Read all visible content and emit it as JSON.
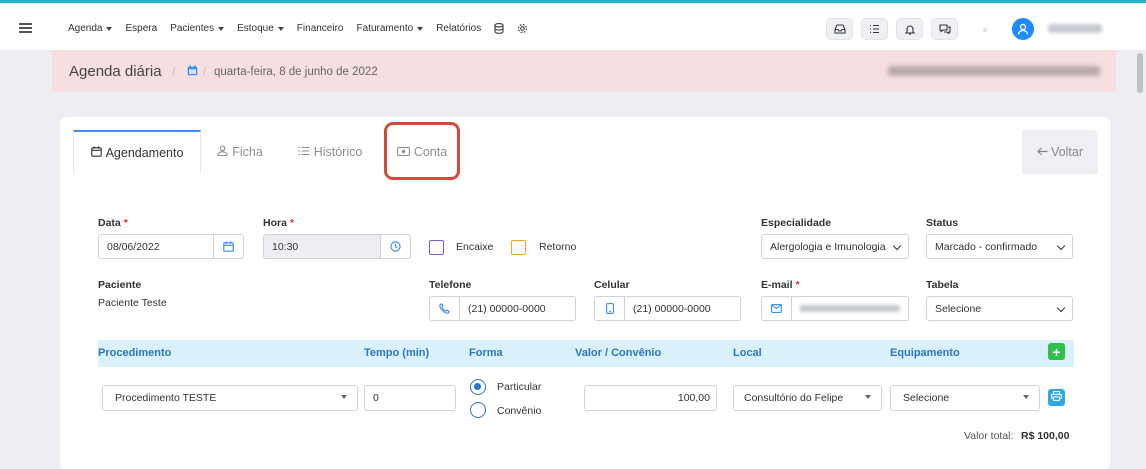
{
  "nav": {
    "items": [
      {
        "label": "Agenda",
        "caret": true
      },
      {
        "label": "Espera",
        "caret": false
      },
      {
        "label": "Pacientes",
        "caret": true
      },
      {
        "label": "Estoque",
        "caret": true
      },
      {
        "label": "Financeiro",
        "caret": false
      },
      {
        "label": "Faturamento",
        "caret": true
      },
      {
        "label": "Relatórios",
        "caret": false
      }
    ],
    "extra_icons": [
      "database-icon",
      "settings-cog-icon"
    ]
  },
  "header_icons": [
    "inbox-icon",
    "checklist-icon",
    "bell-icon",
    "chat-icon"
  ],
  "breadcrumb": {
    "title": "Agenda diária",
    "separator": "/",
    "date": "quarta-feira, 8 de junho de 2022"
  },
  "tabs": {
    "agendamento": "Agendamento",
    "ficha": "Ficha",
    "historico": "Histórico",
    "conta": "Conta",
    "voltar": "Voltar"
  },
  "form": {
    "data_label": "Data",
    "data_value": "08/06/2022",
    "hora_label": "Hora",
    "hora_value": "10:30",
    "encaixe": "Encaixe",
    "retorno": "Retorno",
    "especialidade_label": "Especialidade",
    "especialidade_value": "Alergologia e Imunologia",
    "status_label": "Status",
    "status_value": "Marcado - confirmado",
    "paciente_label": "Paciente",
    "paciente_value": "Paciente Teste",
    "telefone_label": "Telefone",
    "telefone_value": "(21) 00000-0000",
    "celular_label": "Celular",
    "celular_value": "(21) 00000-0000",
    "email_label": "E-mail",
    "tabela_label": "Tabela",
    "tabela_value": "Selecione",
    "required_mark": "*"
  },
  "procedures": {
    "headers": {
      "procedimento": "Procedimento",
      "tempo": "Tempo (min)",
      "forma": "Forma",
      "valor": "Valor / Convênio",
      "local": "Local",
      "equipamento": "Equipamento"
    },
    "row": {
      "procedimento": "Procedimento TESTE",
      "tempo": "0",
      "forma_particular": "Particular",
      "forma_convenio": "Convênio",
      "forma_selected": "Particular",
      "valor": "100,00",
      "local": "Consultório do Felipe",
      "equipamento": "Selecione"
    },
    "total_label": "Valor total:",
    "total_value": "R$ 100,00"
  },
  "colors": {
    "accent": "#1fb8c8",
    "primary_blue": "#2f74c0",
    "highlight_red": "#d14a3c",
    "encaixe": "#7b5cd6",
    "retorno": "#f0a31e",
    "add_green": "#2fc04a"
  }
}
